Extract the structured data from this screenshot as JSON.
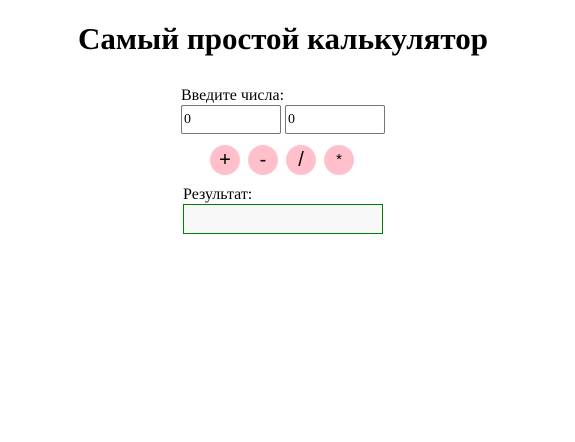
{
  "header": {
    "title": "Самый простой калькулятор"
  },
  "calculator": {
    "input_label": "Введите числа:",
    "first_value": "0",
    "second_value": "0",
    "operations": {
      "add": "+",
      "subtract": "-",
      "divide": "/",
      "multiply": "*"
    },
    "result_label": "Результат:",
    "result_value": ""
  },
  "colors": {
    "button_bg": "#ffc0cb",
    "result_border": "#008000",
    "result_bg": "#f8f8f8"
  }
}
